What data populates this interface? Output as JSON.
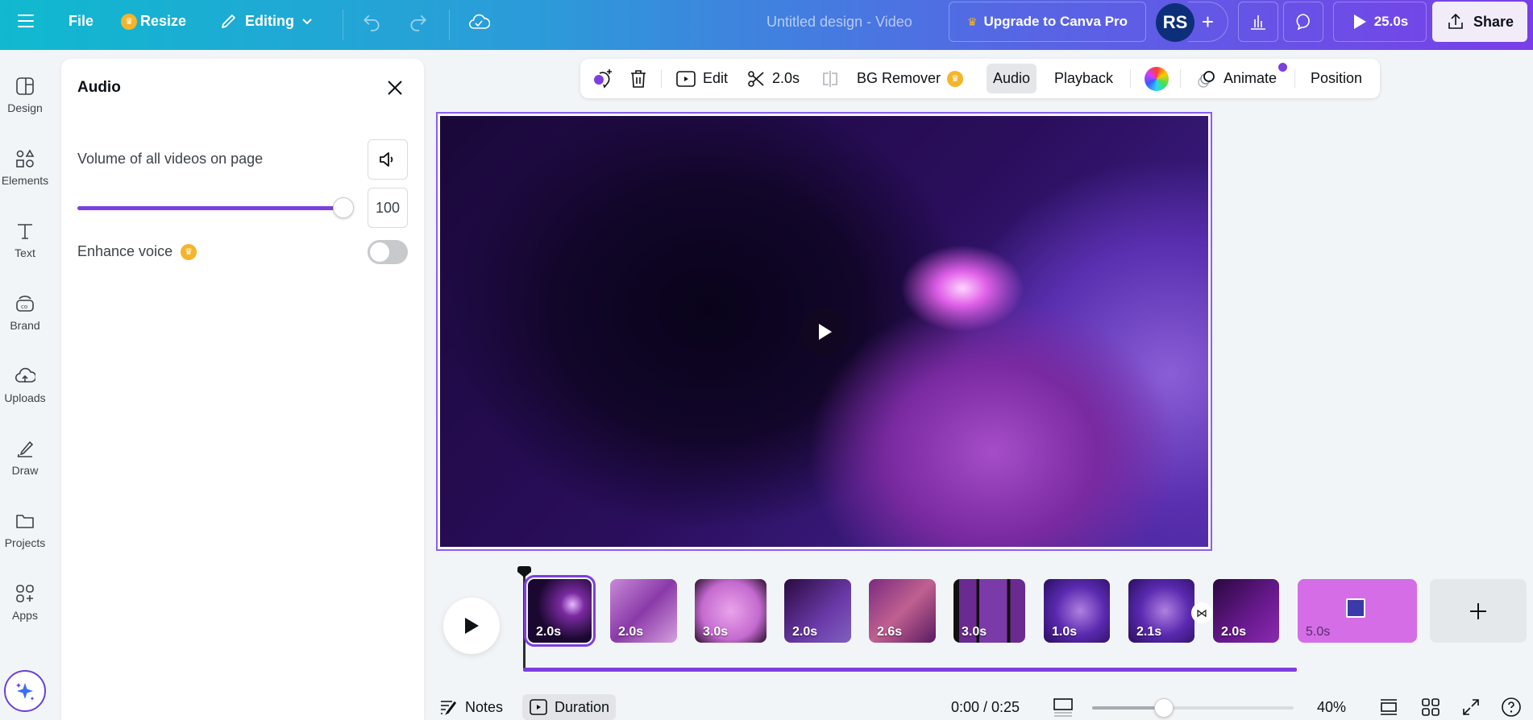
{
  "topbar": {
    "menu_icon": "hamburger-menu-icon",
    "file_label": "File",
    "resize_label": "Resize",
    "editing_label": "Editing",
    "design_title": "Untitled design - Video",
    "upgrade_label": "Upgrade to Canva Pro",
    "avatar_initials": "RS",
    "play_duration": "25.0s",
    "share_label": "Share"
  },
  "rail": {
    "items": [
      {
        "label": "Design",
        "icon": "design-icon"
      },
      {
        "label": "Elements",
        "icon": "elements-icon"
      },
      {
        "label": "Text",
        "icon": "text-icon"
      },
      {
        "label": "Brand",
        "icon": "brand-icon"
      },
      {
        "label": "Uploads",
        "icon": "uploads-icon"
      },
      {
        "label": "Draw",
        "icon": "draw-icon"
      },
      {
        "label": "Projects",
        "icon": "projects-icon"
      },
      {
        "label": "Apps",
        "icon": "apps-icon"
      }
    ],
    "magic_icon": "magic-sparkle-icon"
  },
  "panel": {
    "title": "Audio",
    "volume_label": "Volume of all videos on page",
    "volume_value": "100",
    "volume_percent": 100,
    "enhance_label": "Enhance voice",
    "enhance_on": false
  },
  "context_toolbar": {
    "edit_label": "Edit",
    "split_duration": "2.0s",
    "bg_remover_label": "BG Remover",
    "audio_label": "Audio",
    "playback_label": "Playback",
    "animate_label": "Animate",
    "position_label": "Position"
  },
  "timeline": {
    "clips": [
      {
        "duration": "2.0s",
        "selected": true
      },
      {
        "duration": "2.0s",
        "selected": false
      },
      {
        "duration": "3.0s",
        "selected": false
      },
      {
        "duration": "2.0s",
        "selected": false
      },
      {
        "duration": "2.6s",
        "selected": false
      },
      {
        "duration": "3.0s",
        "selected": false
      },
      {
        "duration": "1.0s",
        "selected": false
      },
      {
        "duration": "2.1s",
        "selected": false
      },
      {
        "duration": "2.0s",
        "selected": false
      },
      {
        "duration": "5.0s",
        "selected": false
      }
    ]
  },
  "bottom": {
    "notes_label": "Notes",
    "duration_label": "Duration",
    "time_readout": "0:00 / 0:25",
    "zoom_value": "40%",
    "zoom_percent": 40
  },
  "colors": {
    "accent": "#7d3fe0",
    "crown": "#f5b52a"
  }
}
